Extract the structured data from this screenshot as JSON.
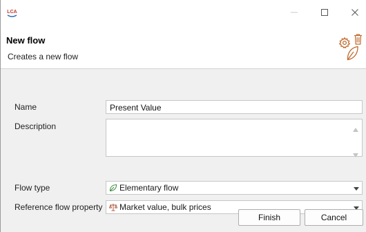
{
  "window": {
    "app_icon": "lca-icon",
    "app_icon_text": "LCA",
    "controls": [
      "minimize-icon",
      "maximize-icon",
      "close-icon"
    ]
  },
  "header": {
    "title": "New flow",
    "subtitle": "Creates a new flow",
    "icons": [
      "gear-icon",
      "trash-icon",
      "leaf-icon"
    ],
    "accent_color": "#c06a2c"
  },
  "form": {
    "name": {
      "label": "Name",
      "value": "Present Value"
    },
    "description": {
      "label": "Description",
      "value": ""
    },
    "flow_type": {
      "label": "Flow type",
      "value": "Elementary flow",
      "icon": "leaf-icon"
    },
    "reference_flow_property": {
      "label": "Reference flow property",
      "value": "Market value, bulk prices",
      "icon": "scale-icon"
    }
  },
  "buttons": {
    "finish": "Finish",
    "cancel": "Cancel"
  }
}
